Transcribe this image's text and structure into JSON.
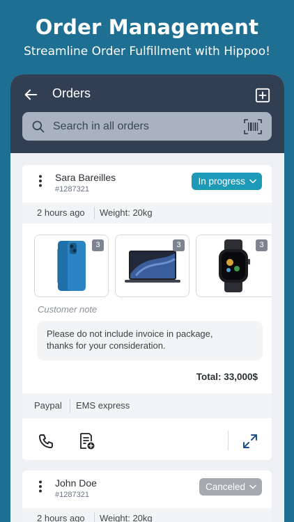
{
  "promo": {
    "title": "Order Management",
    "subtitle": "Streamline Order Fulfillment with Hippoo!"
  },
  "header": {
    "title": "Orders",
    "back_icon": "arrow-left-icon",
    "add_icon": "plus-square-icon"
  },
  "search": {
    "placeholder": "Search in all orders",
    "scan_icon": "barcode-scan-icon"
  },
  "orders": [
    {
      "customer": "Sara Bareilles",
      "number": "#1287321",
      "status": "In progress",
      "status_color": "#1c9ab8",
      "time": "2 hours ago",
      "weight": "Weight: 20kg",
      "products": [
        {
          "name": "iPhone",
          "qty": "3"
        },
        {
          "name": "MacBook",
          "qty": "3"
        },
        {
          "name": "Apple Watch",
          "qty": "3"
        }
      ],
      "note_label": "Customer note",
      "note_line1": "Please do not include invoice in package,",
      "note_line2": "thanks for your consideration.",
      "total": "Total: 33,000$",
      "payment": "Paypal",
      "shipping": "EMS express"
    },
    {
      "customer": "John Doe",
      "number": "#1287321",
      "status": "Canceled",
      "status_color": "#a6a9ad",
      "time": "2 hours ago",
      "weight": "Weight: 20kg"
    }
  ],
  "colors": {
    "background": "#1e6f92",
    "header": "#323f52",
    "accent": "#1c9ab8"
  }
}
